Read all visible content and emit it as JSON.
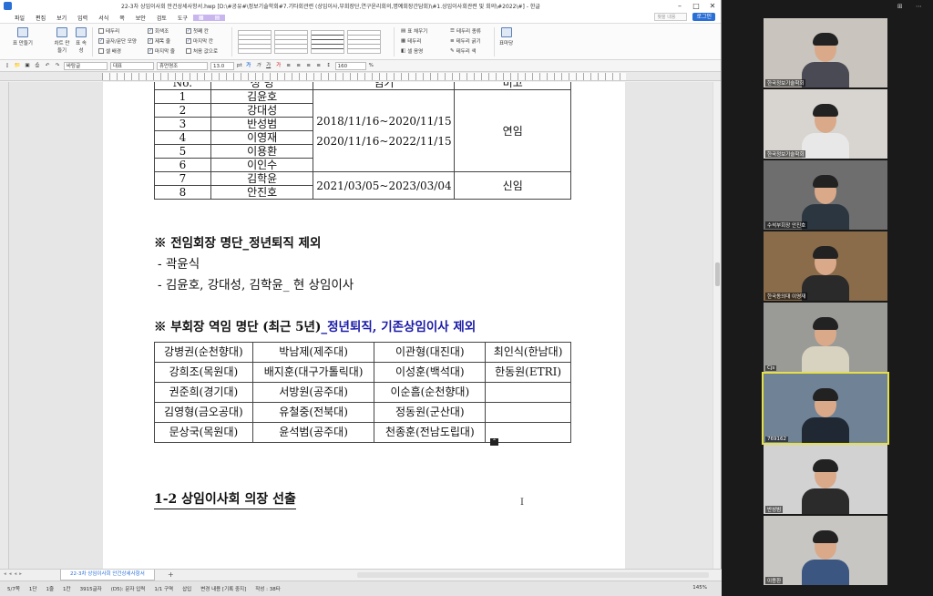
{
  "window": {
    "title": "22-3차 상임이사회 안건상세사항서.hwp [D:\\#공유#\\정보기술학회#7.기타회관련 (상임이사,부회장단,연구윤리회의,명예회장간담회)\\#1.상임이사회관련 및 회의\\#2022\\#] - 한글",
    "controls": [
      "–",
      "□",
      "✕"
    ]
  },
  "menubar": {
    "items": [
      "파일",
      "편집",
      "보기",
      "입력",
      "서식",
      "쪽",
      "보안",
      "검토",
      "도구"
    ],
    "search_placeholder": "찾을 내용",
    "login_label": "로그인"
  },
  "ribbon": {
    "btn_table": "표 만들기",
    "btn_chart": "차트 만들기",
    "btn_props": "표 속성",
    "checks": [
      {
        "label": "테두리",
        "checked": false
      },
      {
        "label": "글자/문단 모양",
        "checked": true
      },
      {
        "label": "셀 배경",
        "checked": false
      },
      {
        "label": "회색조",
        "checked": true
      },
      {
        "label": "제목 줄",
        "checked": true
      },
      {
        "label": "마지막 줄",
        "checked": true
      },
      {
        "label": "첫째 칸",
        "checked": true
      },
      {
        "label": "마지막 칸",
        "checked": true
      },
      {
        "label": "처음 값으로",
        "checked": false
      }
    ],
    "right_items": [
      "표 채우기",
      "테두리",
      "셀 음영",
      "테두리 종류",
      "테두리 굵기",
      "테두리 색"
    ],
    "btn_formula": "표마당"
  },
  "formatbar": {
    "style": "바탕글",
    "lang": "대표",
    "font": "휴먼명조",
    "size": "13.0",
    "unit": "pt",
    "zoom": "160",
    "zoom_unit": "%"
  },
  "doc": {
    "table1": {
      "header": [
        "No.",
        "성 명",
        "임기",
        "비고"
      ],
      "rows": [
        {
          "no": "1",
          "name": "김윤호"
        },
        {
          "no": "2",
          "name": "강대성"
        },
        {
          "no": "3",
          "name": "반성범"
        },
        {
          "no": "4",
          "name": "이영재"
        },
        {
          "no": "5",
          "name": "이용환"
        },
        {
          "no": "6",
          "name": "이인수"
        },
        {
          "no": "7",
          "name": "김학윤"
        },
        {
          "no": "8",
          "name": "안진호"
        }
      ],
      "term_a_line1": "2018/11/16~2020/11/15",
      "term_a_line2": "2020/11/16~2022/11/15",
      "note_a": "연임",
      "term_b": "2021/03/05~2023/03/04",
      "note_b": "신임"
    },
    "section1_heading": "※ 전임회장 명단_정년퇴직 제외",
    "section1_item1": "- 곽윤식",
    "section1_item2": "- 김윤호, 강대성, 김학윤_ 현 상임이사",
    "section2_heading_black": "※ 부회장 역임 명단 (최근 5년)",
    "section2_heading_blue": "_정년퇴직, 기존상임이사 제외",
    "table2": [
      [
        "강병권(순천향대)",
        "박남제(제주대)",
        "이관형(대진대)",
        "최인식(한남대)"
      ],
      [
        "강희조(목원대)",
        "배지훈(대구가톨릭대)",
        "이성훈(백석대)",
        "한동원(ETRI)"
      ],
      [
        "권준희(경기대)",
        "서방원(공주대)",
        "이순흠(순천향대)",
        ""
      ],
      [
        "김영형(금오공대)",
        "유철중(전북대)",
        "정동원(군산대)",
        ""
      ],
      [
        "문상국(목원대)",
        "윤석범(공주대)",
        "천종훈(전남도립대)",
        ""
      ]
    ],
    "section3_heading": "1-2 상임이사회 의장 선출"
  },
  "tabbar": {
    "tab_label": "22-3차 상임이사회 안건상세사항서",
    "add": "+"
  },
  "statusbar": {
    "items": [
      "5/7쪽",
      "1단",
      "1줄",
      "1칸",
      "3915글자",
      "(D5): 문자 입력",
      "1/1 구역",
      "삽입",
      "변경 내용 [기록 중지]",
      "작성 : 38타"
    ],
    "zoom": "145%"
  },
  "participants": [
    {
      "label": "한국정보기술학회"
    },
    {
      "label": "한국정보기술학회"
    },
    {
      "label": "수석부회장 안진호"
    },
    {
      "label": "한국동의대 이영재"
    },
    {
      "label": "Cjs"
    },
    {
      "label": "769162"
    },
    {
      "label": "반성범"
    },
    {
      "label": "이용환"
    }
  ]
}
